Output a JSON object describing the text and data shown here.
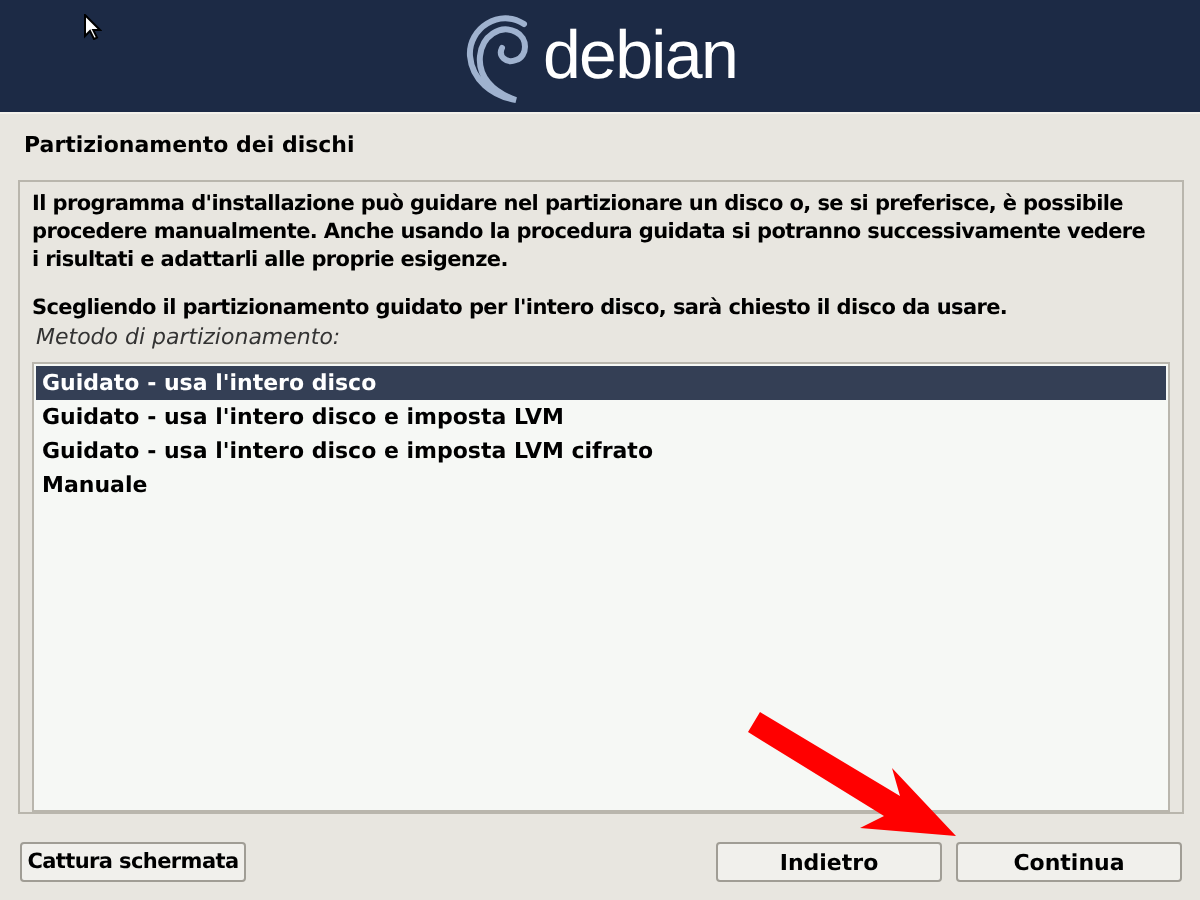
{
  "header": {
    "logo_text": "debian"
  },
  "title": "Partizionamento dei dischi",
  "paragraphs": [
    "Il programma d'installazione può guidare nel partizionare un disco o, se si preferisce, è possibile procedere manualmente. Anche usando la procedura guidata si potranno successivamente vedere i risultati e adattarli alle proprie esigenze.",
    "Scegliendo il partizionamento guidato per l'intero disco, sarà chiesto il disco da usare."
  ],
  "list_label": "Metodo di partizionamento:",
  "options": [
    {
      "label": "Guidato - usa l'intero disco",
      "selected": true
    },
    {
      "label": "Guidato - usa l'intero disco e imposta LVM",
      "selected": false
    },
    {
      "label": "Guidato - usa l'intero disco e imposta LVM cifrato",
      "selected": false
    },
    {
      "label": "Manuale",
      "selected": false
    }
  ],
  "buttons": {
    "screenshot": "Cattura schermata",
    "back": "Indietro",
    "continue": "Continua"
  }
}
